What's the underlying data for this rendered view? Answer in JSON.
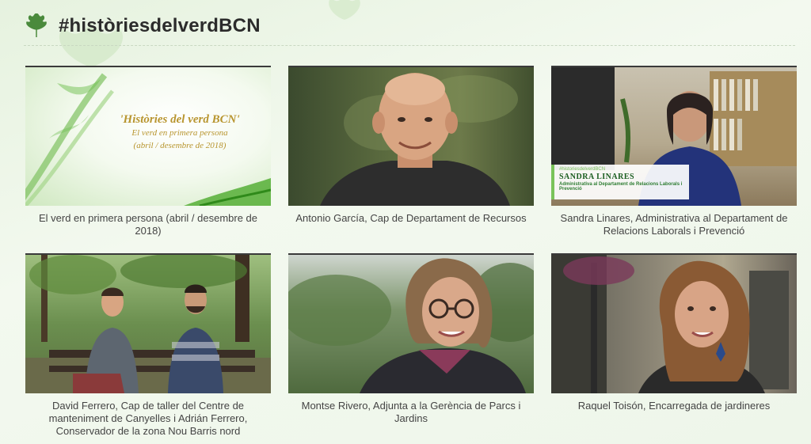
{
  "header": {
    "title": "#històriesdelverdBCN",
    "logo_icon": "maple-leaf-icon"
  },
  "colors": {
    "accent": "#4a8a3c",
    "background": "#eef6ea",
    "text": "#333333"
  },
  "videos": [
    {
      "caption": "El verd en primera persona (abril / desembre de 2018)",
      "title_card": {
        "line1": "'Històries del verd BCN'",
        "line2": "El verd en primera persona",
        "line3": "(abril / desembre de 2018)"
      }
    },
    {
      "caption": "Antonio García, Cap de Departament de Recursos"
    },
    {
      "caption": "Sandra Linares, Administrativa al Departament de Relacions Laborals i Prevenció",
      "lower_third": {
        "tag": "#historiesdelverdBCN",
        "name": "SANDRA LINARES",
        "role": "Administrativa al Departament de Relacions Laborals i Prevenció"
      }
    },
    {
      "caption": "David Ferrero, Cap de taller del Centre de manteniment de Canyelles i Adrián Ferrero, Conservador de la zona Nou Barris nord"
    },
    {
      "caption": "Montse Rivero, Adjunta a la Gerència de Parcs i Jardins"
    },
    {
      "caption": "Raquel Toisón, Encarregada de jardineres"
    }
  ]
}
